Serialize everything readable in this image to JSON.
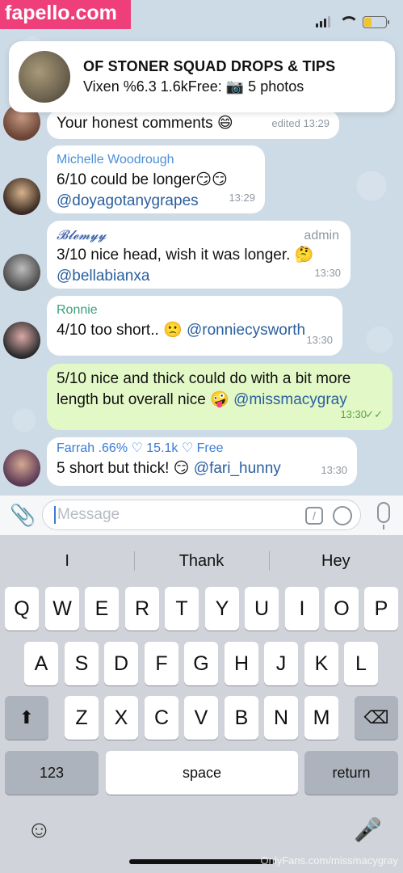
{
  "watermark": "fapello.com",
  "notification": {
    "title": "OF STONER SQUAD DROPS & TIPS",
    "body": "Vixen %6.3 1.6kFree: 📷 5 photos"
  },
  "messages": [
    {
      "text": "Your honest comments 😄",
      "time": "edited 13:29"
    },
    {
      "sender": "Michelle Woodrough",
      "sender_color": "#4a90d9",
      "text": "6/10 could be longer😏😏",
      "mention": "@doyagotanygrapes",
      "time": "13:29"
    },
    {
      "sender": "𝓑𝓵𝓮𝓶𝔂𝔂",
      "sender_color": "#3a5fa8",
      "role": "admin",
      "text": "3/10 nice head, wish it was longer. 🤔",
      "mention": "@bellabianxa",
      "time": "13:30"
    },
    {
      "sender": "Ronnie",
      "sender_color": "#3aa37a",
      "text": "4/10 too short.. 🙁",
      "mention": "@ronniecysworth",
      "time": "13:30"
    },
    {
      "text": "5/10 nice and thick could do with a bit more length but overall nice 🤪",
      "mention": "@missmacygray",
      "time": "13:30"
    },
    {
      "sender": "Farrah .66% ♡ 15.1k ♡ Free",
      "sender_color": "#3a7bd5",
      "text": "5 short but thick! 😏",
      "mention": "@fari_hunny",
      "time": "13:30"
    }
  ],
  "input": {
    "placeholder": "Message"
  },
  "keyboard": {
    "suggestions": [
      "I",
      "Thank",
      "Hey"
    ],
    "row1": [
      "Q",
      "W",
      "E",
      "R",
      "T",
      "Y",
      "U",
      "I",
      "O",
      "P"
    ],
    "row2": [
      "A",
      "S",
      "D",
      "F",
      "G",
      "H",
      "J",
      "K",
      "L"
    ],
    "row3": [
      "Z",
      "X",
      "C",
      "V",
      "B",
      "N",
      "M"
    ],
    "numbers_key": "123",
    "space_key": "space",
    "return_key": "return"
  },
  "footer_watermark": "OnlyFans.com/missmacygray"
}
